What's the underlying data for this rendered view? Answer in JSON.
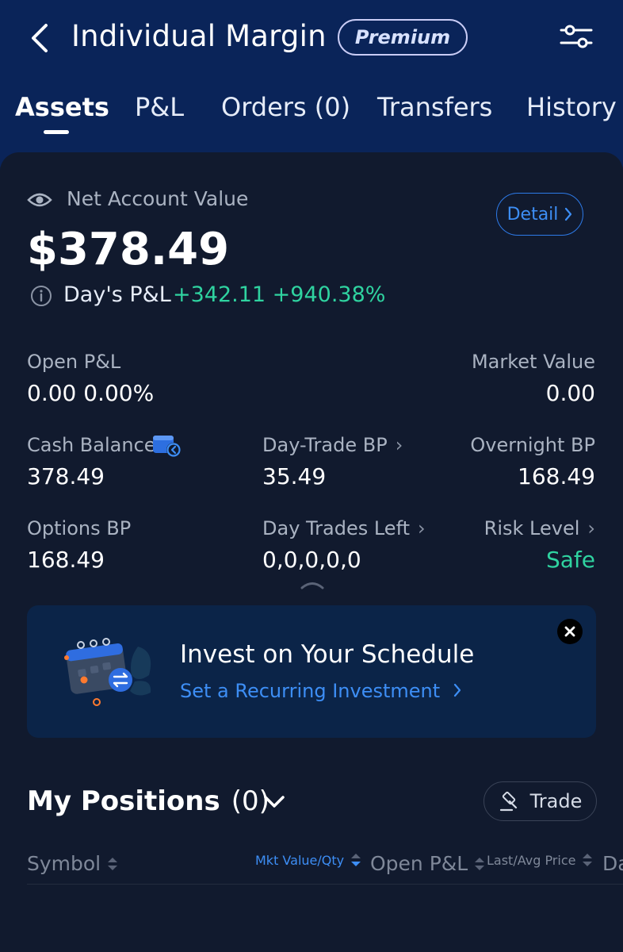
{
  "header": {
    "title": "Individual Margin",
    "badge": "Premium"
  },
  "tabs": [
    {
      "label": "Assets",
      "active": true
    },
    {
      "label": "P&L"
    },
    {
      "label": "Orders (0)"
    },
    {
      "label": "Transfers"
    },
    {
      "label": "History"
    }
  ],
  "account": {
    "label": "Net Account Value",
    "value": "$378.49",
    "detail_label": "Detail",
    "day_pl_label": "Day's P&L",
    "day_pl_value": "+342.11 +940.38%"
  },
  "stats": {
    "open_pl": {
      "label": "Open P&L",
      "value": "0.00 0.00%"
    },
    "market_value": {
      "label": "Market Value",
      "value": "0.00"
    },
    "cash_balance": {
      "label": "Cash Balance",
      "value": "378.49"
    },
    "day_trade_bp": {
      "label": "Day-Trade BP",
      "value": "35.49"
    },
    "overnight_bp": {
      "label": "Overnight BP",
      "value": "168.49"
    },
    "options_bp": {
      "label": "Options BP",
      "value": "168.49"
    },
    "day_trades_left": {
      "label": "Day Trades Left",
      "value": "0,0,0,0,0"
    },
    "risk_level": {
      "label": "Risk Level",
      "value": "Safe"
    }
  },
  "promo": {
    "title": "Invest on Your Schedule",
    "link": "Set a Recurring Investment"
  },
  "positions": {
    "title": "My Positions",
    "count": "(0)",
    "trade_label": "Trade",
    "columns": [
      "Symbol",
      "Mkt Value/Qty",
      "Open P&L",
      "Last/Avg Price",
      "Da"
    ]
  },
  "colors": {
    "header_bg": "#0a2459",
    "panel_bg": "#111a2e",
    "accent_blue": "#3d8ef5",
    "gain_green": "#2fd3a0"
  }
}
